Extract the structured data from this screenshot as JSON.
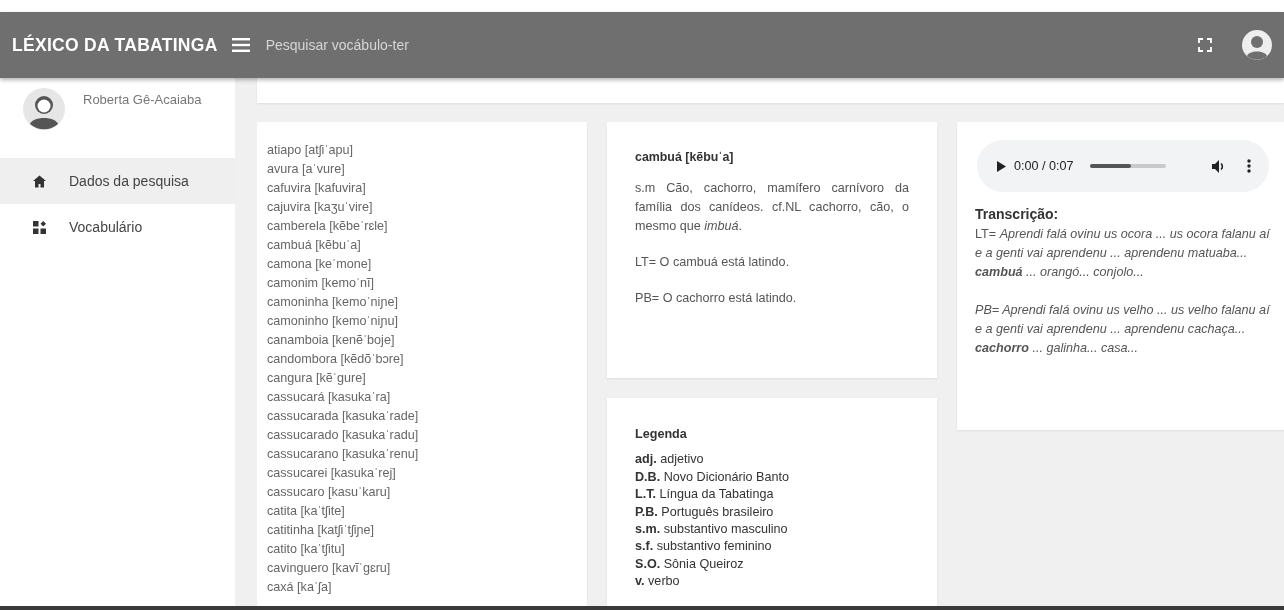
{
  "navbar": {
    "brand": "LÉXICO DA TABATINGA",
    "search": {
      "placeholder": "Pesquisar vocábulo-ter"
    }
  },
  "sidebar": {
    "user": "Roberta Gê-Acaiaba",
    "items": [
      {
        "label": "Dados da pesquisa",
        "kind": "home",
        "selected": true
      },
      {
        "label": "Vocabulário",
        "kind": "grid",
        "selected": false
      }
    ]
  },
  "word_list": [
    "atiapo [atʃiˈapu]",
    "avura [aˈvure]",
    "cafuvira [kafuvira]",
    "cajuvira [kaʒuˈvire]",
    "camberela [kẽbeˈrɛle]",
    "cambuá [kẽbuˈa]",
    "camona [keˈmone]",
    "camonim [kemoˈnĩ]",
    "camoninha [kemoˈniɲe]",
    "camoninho [kemoˈniɲu]",
    "canamboia [kenẽˈboje]",
    "candombora [kẽdõˈbɔre]",
    "cangura [kẽˈgure]",
    "cassucará [kasukaˈra]",
    "cassucarada [kasukaˈrade]",
    "cassucarado [kasukaˈradu]",
    "cassucarano [kasukaˈrenu]",
    "cassucarei [kasukaˈrej]",
    "cassucaro [kasuˈkaru]",
    "catita [kaˈtʃite]",
    "catitinha [katʃiˈtʃiɲe]",
    "catito [kaˈtʃitu]",
    "cavinguero [kavĩˈgɛru]",
    "caxá [kaˈʃa]"
  ],
  "entry": {
    "title": "cambuá [kẽbuˈa]",
    "definition": "s.m Cão, cachorro, mamífero carnívoro da família dos canídeos. cf.NL cachorro, cão, o mesmo que *imbuá*.",
    "examples": [
      "LT= O cambuá está latindo.",
      "PB= O cachorro está latindo."
    ]
  },
  "legend": {
    "title": "Legenda",
    "items": [
      {
        "abbr": "adj.",
        "text": "adjetivo"
      },
      {
        "abbr": "D.B.",
        "text": "Novo Dicionário Banto"
      },
      {
        "abbr": "L.T.",
        "text": "Língua da Tabatinga"
      },
      {
        "abbr": "P.B.",
        "text": "Português brasileiro"
      },
      {
        "abbr": "s.m.",
        "text": "substantivo masculino"
      },
      {
        "abbr": "s.f.",
        "text": "substantivo feminino"
      },
      {
        "abbr": "S.O.",
        "text": "Sônia Queiroz"
      },
      {
        "abbr": "v.",
        "text": "verbo"
      }
    ]
  },
  "audio": {
    "time": "0:00 / 0:07",
    "level": 0.55
  },
  "transcription": {
    "title": "Transcrição:",
    "paragraphs": [
      {
        "prefix": "LT=",
        "text": "Aprendi falá ovinu us ocora ... us ocora falanu aí e a genti vai aprendenu ... aprendenu matuaba... **cambuá** ... orangó... conjolo..."
      },
      {
        "text": "PB= Aprendi falá ovinu us velho ... us velho falanu aí e a genti vai aprendenu ... aprendenu cachaça... **cachorro** ... galinha... casa..."
      }
    ]
  }
}
